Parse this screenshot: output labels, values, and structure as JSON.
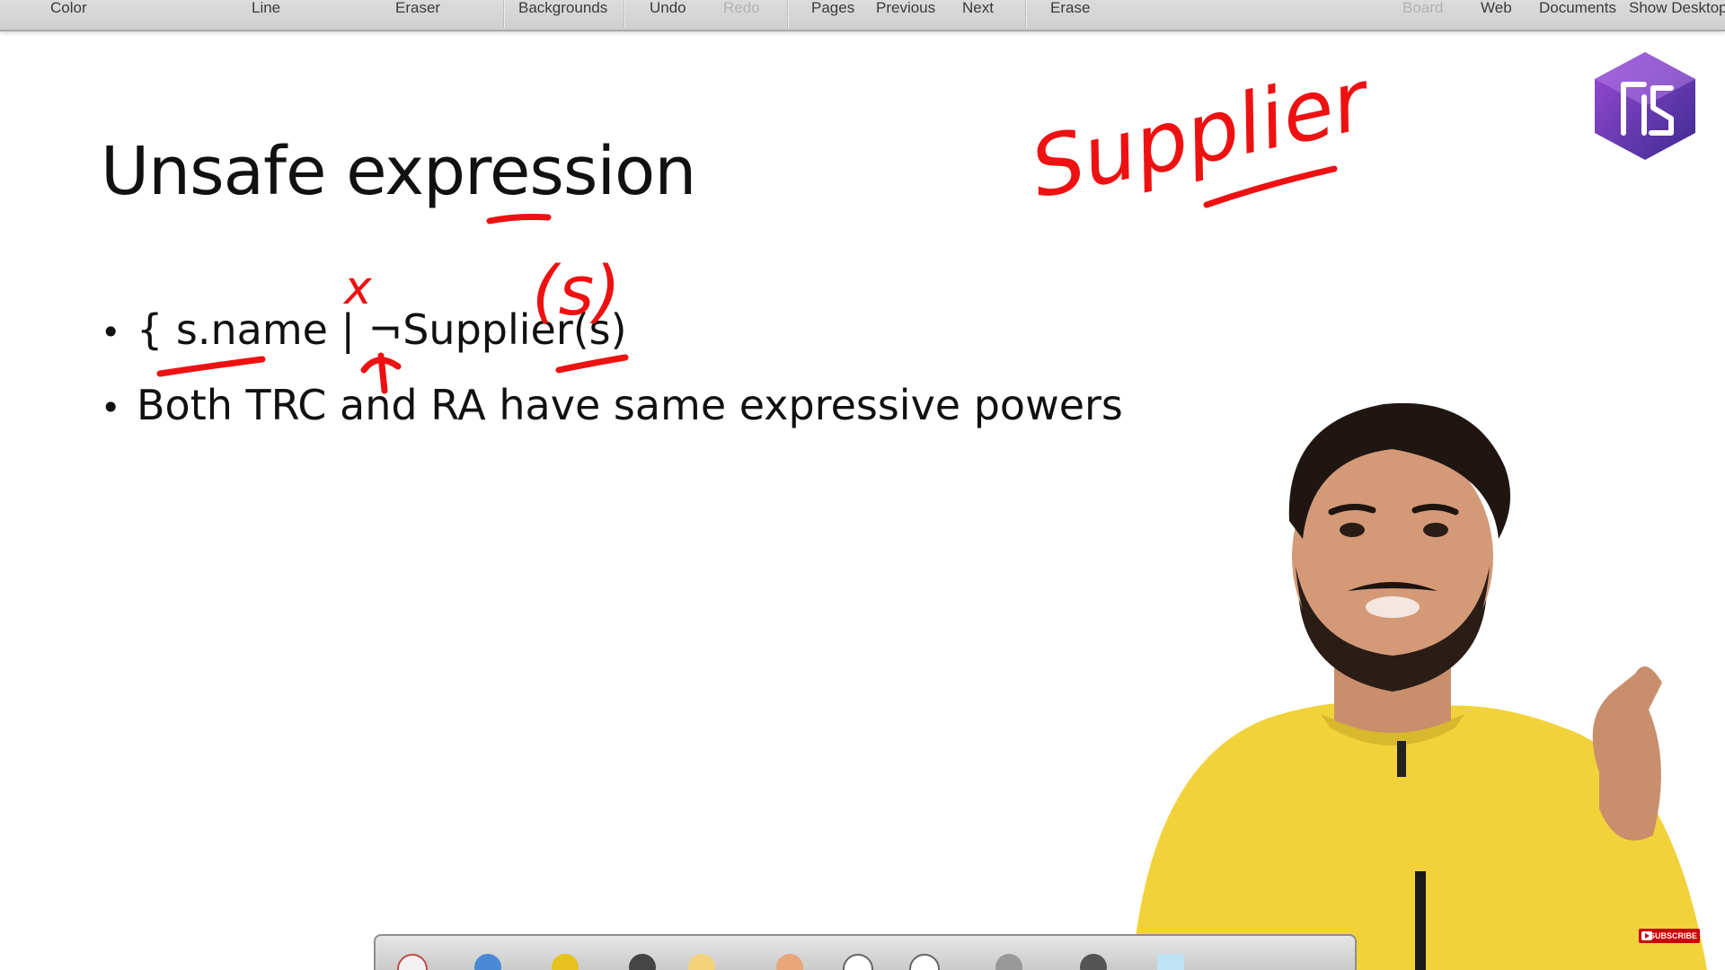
{
  "toolbar": {
    "color": "Color",
    "line": "Line",
    "eraser": "Eraser",
    "backgrounds": "Backgrounds",
    "undo": "Undo",
    "redo": "Redo",
    "pages": "Pages",
    "previous": "Previous",
    "next": "Next",
    "erase": "Erase",
    "board": "Board",
    "web": "Web",
    "documents": "Documents",
    "show_desktop": "Show Desktop"
  },
  "slide": {
    "title": "Unsafe expression",
    "bullet_glyph": "•",
    "bullets": [
      "{ s.name | ¬Supplier(s)",
      "Both TRC and RA have same expressive powers"
    ]
  },
  "annotations": {
    "supplier": "Supplier",
    "paren_s": "(s)",
    "cross": "x"
  },
  "badge": {
    "subscribe": "SUBSCRIBE"
  },
  "colors": {
    "ink": "#ee1111",
    "logo_dark": "#3b2b8f",
    "logo_light": "#9b4bd6",
    "shirt": "#f2d23a"
  },
  "icons": {
    "logo": "gs-hexagon-logo",
    "subscribe": "youtube-play-icon"
  }
}
